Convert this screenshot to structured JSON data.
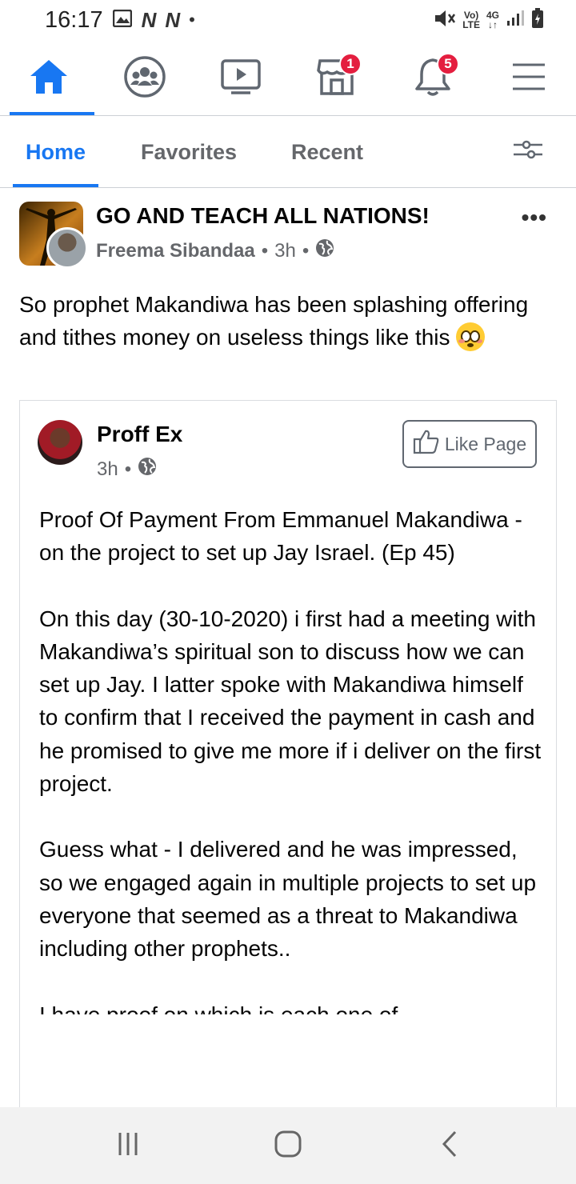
{
  "status_bar": {
    "time": "16:17",
    "indicators": [
      "image-icon",
      "N",
      "N",
      "•"
    ],
    "network_label_top": "Vo)",
    "network_label_bottom": "LTE",
    "data_type": "4G"
  },
  "nav": {
    "items": [
      {
        "name": "home",
        "icon": "home-icon",
        "active": true
      },
      {
        "name": "groups",
        "icon": "groups-icon"
      },
      {
        "name": "watch",
        "icon": "video-icon"
      },
      {
        "name": "marketplace",
        "icon": "marketplace-icon",
        "badge": "1"
      },
      {
        "name": "notifications",
        "icon": "bell-icon",
        "badge": "5"
      },
      {
        "name": "menu",
        "icon": "menu-icon"
      }
    ],
    "accent": "#1877f2",
    "badge_color": "#e41e3f"
  },
  "tabs": {
    "home": "Home",
    "favorites": "Favorites",
    "recent": "Recent"
  },
  "post": {
    "group_name": "GO AND TEACH ALL NATIONS!",
    "author": "Freema Sibandaa",
    "time": "3h",
    "separator": "•",
    "more": "•••",
    "text": "So prophet Makandiwa has been splashing offering and tithes money on useless things like this "
  },
  "shared": {
    "page_name": "Proff Ex",
    "time": "3h",
    "separator": "•",
    "like_button": "Like Page",
    "paragraphs": [
      "Proof Of Payment From Emmanuel Makandiwa - on the project to set up Jay Israel. (Ep 45)",
      "On this day (30-10-2020) i first had a meeting with Makandiwa’s spiritual son to discuss how we can set up Jay. I latter spoke with Makandiwa himself to confirm that I received the payment in cash and he promised to give me more if i deliver on the first project.",
      "Guess what - I delivered and he was impressed, so we engaged again in multiple projects to set up everyone that seemed as a threat to Makandiwa including other prophets..",
      "I have proof on which is each one of"
    ]
  }
}
